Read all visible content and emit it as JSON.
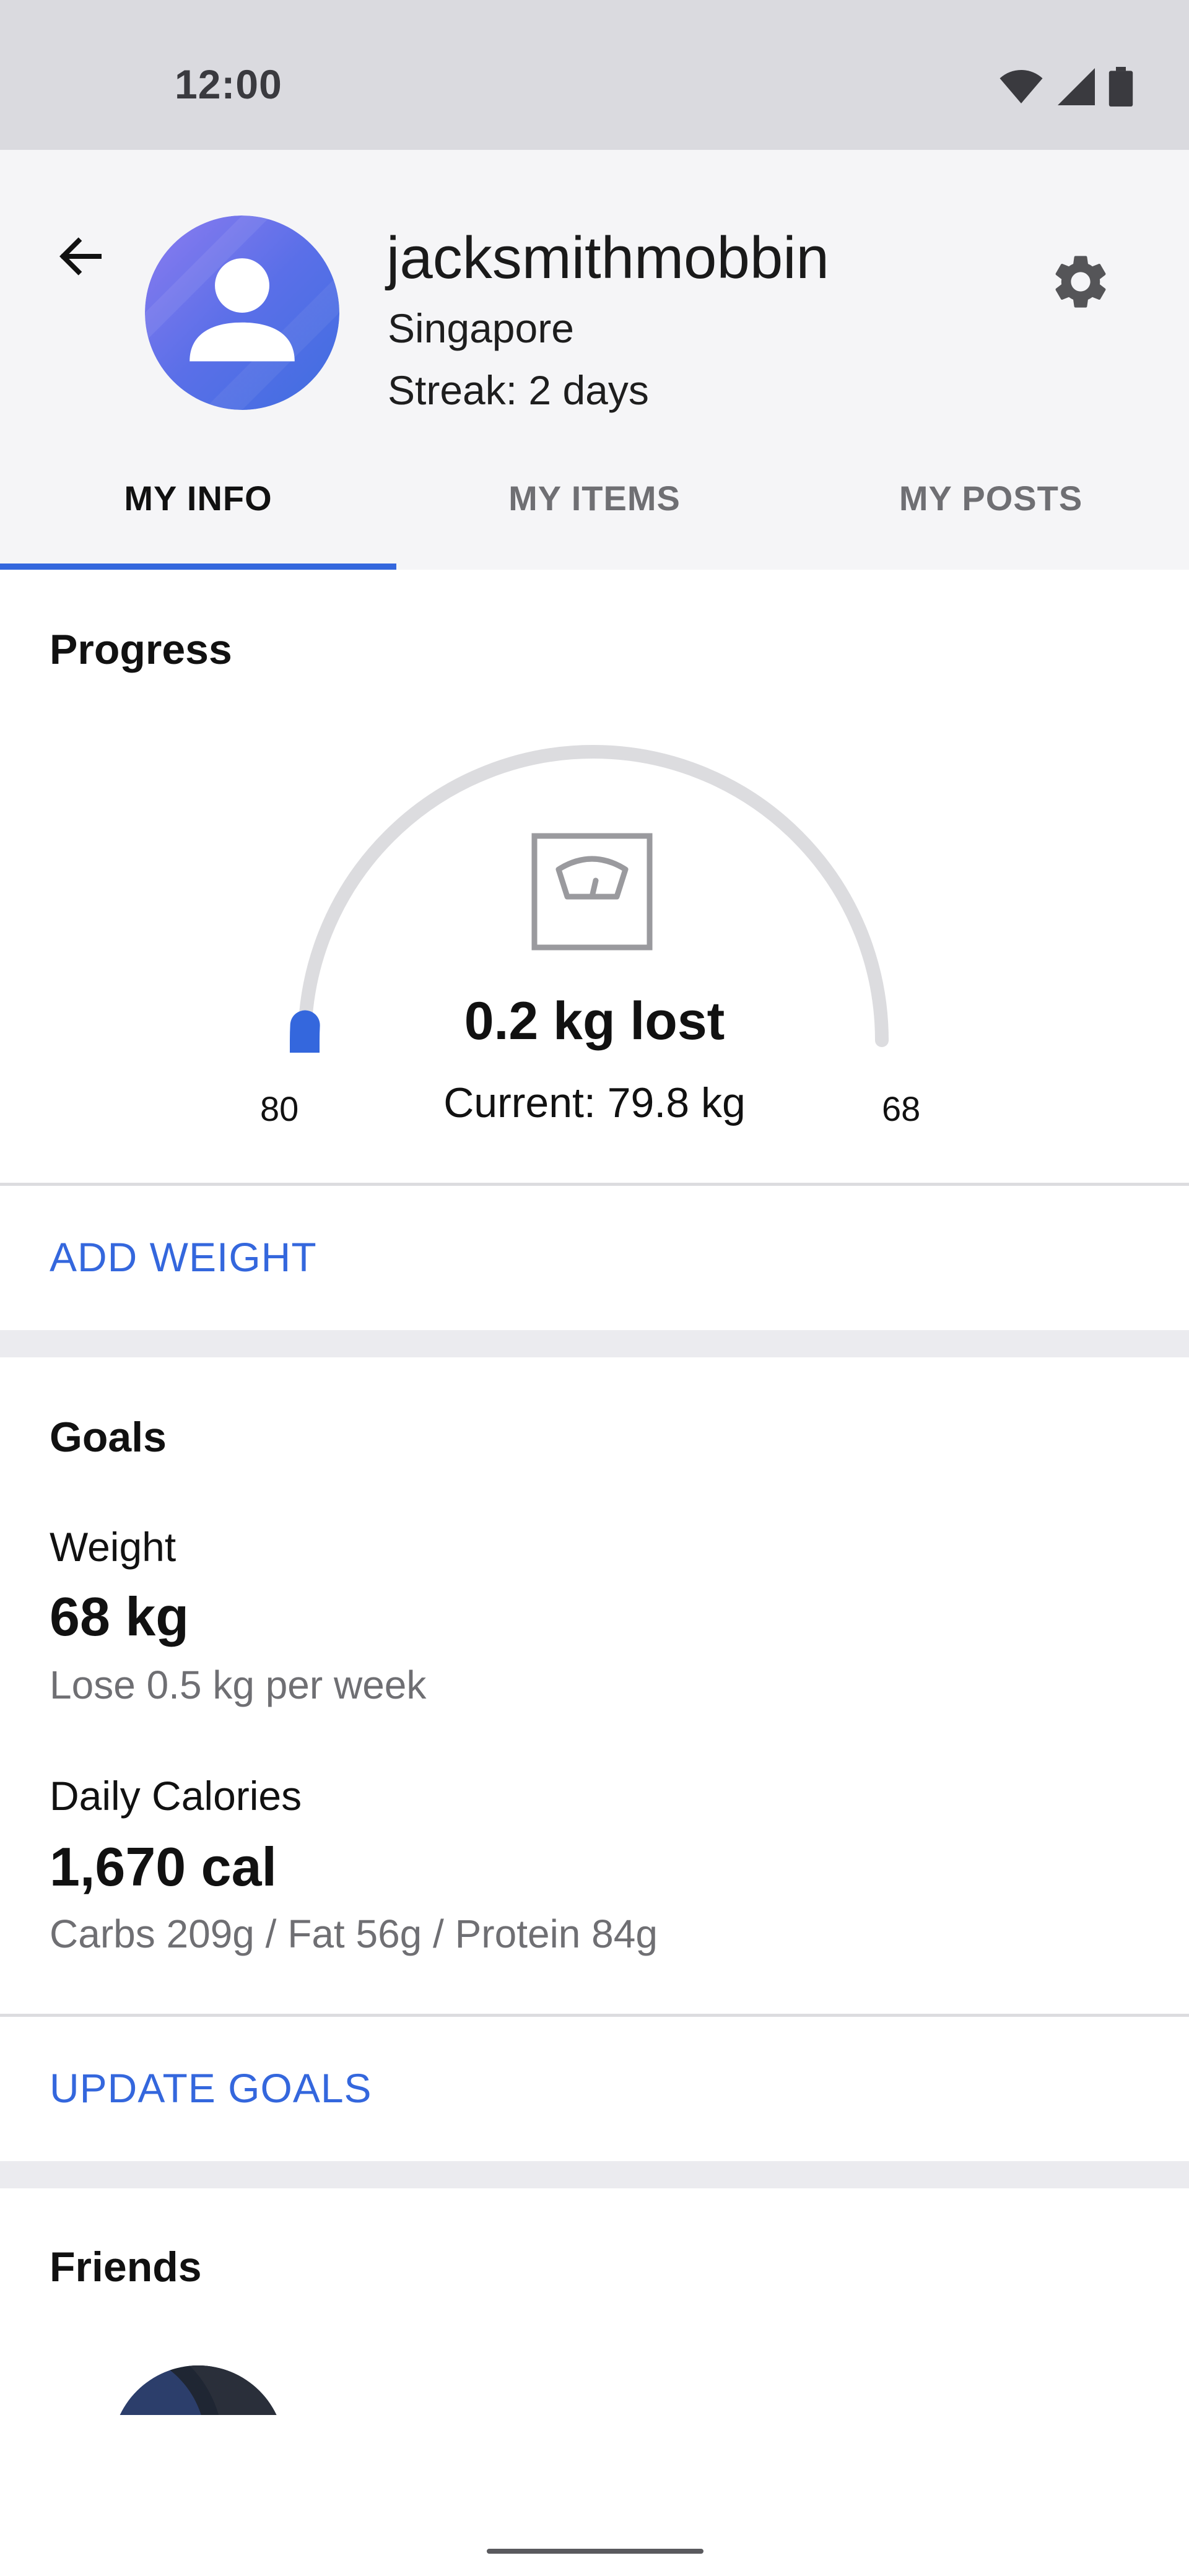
{
  "status_bar": {
    "time": "12:00"
  },
  "header": {
    "username": "jacksmithmobbin",
    "location": "Singapore",
    "streak": "Streak: 2 days"
  },
  "tabs": [
    {
      "label": "MY INFO",
      "active": true
    },
    {
      "label": "MY ITEMS",
      "active": false
    },
    {
      "label": "MY POSTS",
      "active": false
    }
  ],
  "progress": {
    "title": "Progress",
    "lost_text": "0.2 kg lost",
    "current_text": "Current: 79.8 kg",
    "start_weight": "80",
    "goal_weight": "68",
    "progress_fraction": 0.0167,
    "action_label": "ADD WEIGHT"
  },
  "goals": {
    "title": "Goals",
    "weight_label": "Weight",
    "weight_value": "68 kg",
    "weight_sub": "Lose 0.5 kg per week",
    "calories_label": "Daily Calories",
    "calories_value": "1,670 cal",
    "calories_sub": "Carbs 209g / Fat 56g / Protein 84g",
    "action_label": "UPDATE GOALS"
  },
  "friends": {
    "title": "Friends"
  },
  "colors": {
    "accent": "#3467dd",
    "status_bar_bg": "#dadadf",
    "header_bg": "#f5f5f7",
    "gauge_track": "#dcdcdf",
    "muted_text": "#6f6f73"
  }
}
